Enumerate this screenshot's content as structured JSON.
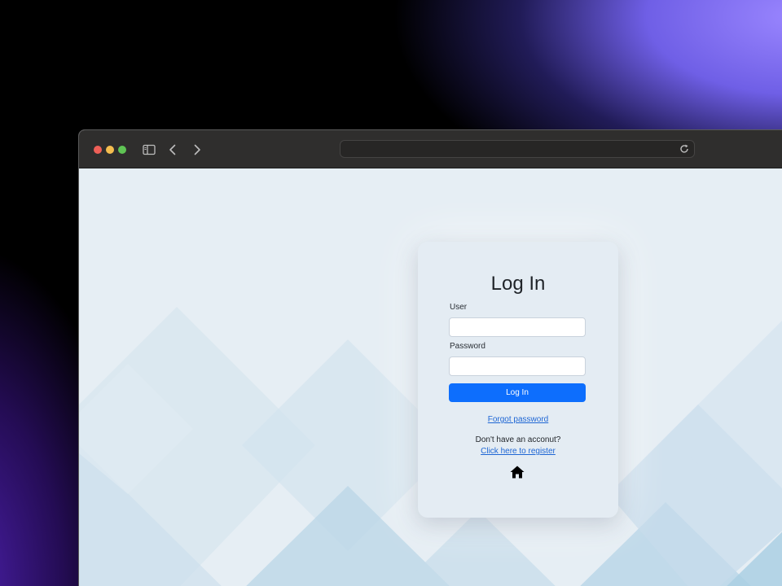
{
  "browser": {
    "url": "",
    "toolbar_icons": [
      "sidebar-toggle-icon",
      "back-arrow-icon",
      "forward-arrow-icon",
      "reload-icon"
    ]
  },
  "login": {
    "title": "Log In",
    "user_label": "User",
    "user_value": "",
    "password_label": "Password",
    "password_value": "",
    "submit_label": "Log In",
    "forgot_label": "Forgot password",
    "no_account_text": "Don't have an acconut?",
    "register_label": "Click here to register",
    "home_icon": "home-icon"
  },
  "colors": {
    "accent": "#0d6efd",
    "link": "#1e66d4",
    "page_bg": "#e6eef4",
    "titlebar": "#2f2e2d"
  }
}
